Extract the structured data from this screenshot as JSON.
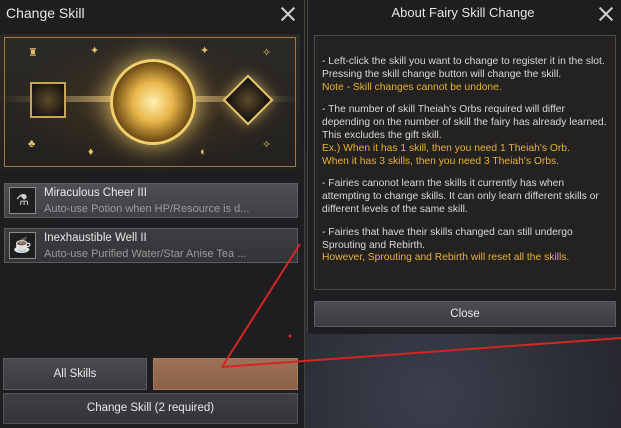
{
  "change_skill": {
    "title": "Change Skill",
    "skills": [
      {
        "name": "Miraculous Cheer III",
        "desc": "Auto-use Potion when HP/Resource is d...",
        "icon": "potion-icon"
      },
      {
        "name": "Inexhaustible Well II",
        "desc": "Auto-use Purified Water/Star Anise Tea ...",
        "icon": "well-icon"
      }
    ],
    "buttons": {
      "all_skills": "All Skills",
      "change_skill": "Change Skill (2 required)"
    },
    "accent_color": "#e7b12e"
  },
  "about": {
    "title": "About Fairy Skill Change",
    "p1": "- Left-click the skill you want to change to register it in the slot. Pressing the skill change button will change the skill.",
    "p1_note": "Note - Skill changes cannot be undone.",
    "p2": "- The number of skill Theiah's Orbs required will differ depending on the number of skill the fairy has already learned. This excludes the gift skill.",
    "p2_ex1": "Ex.) When it has 1 skill, then you need 1 Theiah's Orb.",
    "p2_ex2": "When it has 3 skills, then you need 3 Theiah's Orbs.",
    "p3": "- Fairies canonot learn the skills it currently has when attempting to change skills. It can only learn different skills or different levels of the same skill.",
    "p4": "- Fairies that have their skills changed can still undergo Sprouting and Rebirth.",
    "p4_note": "However, Sprouting and Rebirth will reset all the skills.",
    "close_label": "Close"
  }
}
